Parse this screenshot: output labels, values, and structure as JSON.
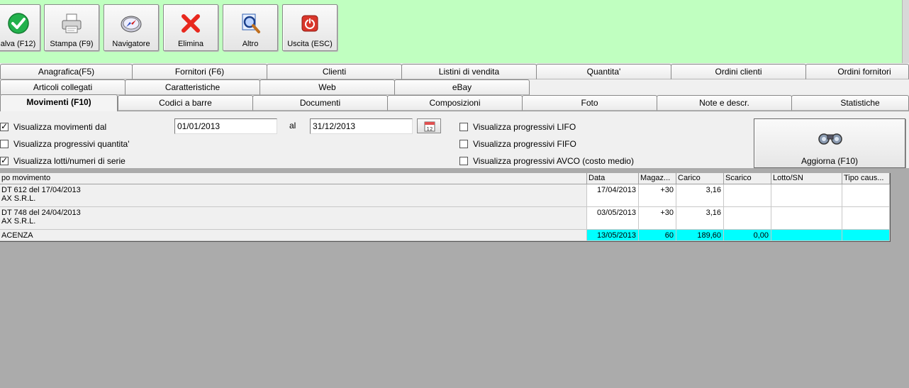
{
  "toolbar": {
    "buttons": [
      {
        "label": "alva (F12)",
        "icon": "check-icon"
      },
      {
        "label": "Stampa (F9)",
        "icon": "printer-icon"
      },
      {
        "label": "Navigatore",
        "icon": "compass-icon"
      },
      {
        "label": "Elimina",
        "icon": "delete-x-icon"
      },
      {
        "label": "Altro",
        "icon": "search-doc-icon"
      },
      {
        "label": "Uscita (ESC)",
        "icon": "power-icon"
      }
    ],
    "colors": {
      "background": "#c0ffc0",
      "check": "#22b14c",
      "delete": "#e8281e",
      "exit": "#d9362b"
    }
  },
  "tabs": {
    "row1": [
      "Anagrafica(F5)",
      "Fornitori (F6)",
      "Clienti",
      "Listini di vendita",
      "Quantita'",
      "Ordini clienti",
      "Ordini fornitori"
    ],
    "row2": [
      "Articoli collegati",
      "Caratteristiche",
      "Web",
      "eBay"
    ],
    "row3": [
      "Movimenti (F10)",
      "Codici a barre",
      "Documenti",
      "Composizioni",
      "Foto",
      "Note e descr.",
      "Statistiche"
    ],
    "active": "Movimenti (F10)"
  },
  "filters": {
    "show_movements": {
      "label": "Visualizza movimenti dal",
      "checked": true
    },
    "show_qty_progressive": {
      "label": "Visualizza progressivi quantita'",
      "checked": false
    },
    "show_lots": {
      "label": "Visualizza lotti/numeri di serie",
      "checked": true
    },
    "date_from": "01/01/2013",
    "al_label": "al",
    "date_to": "31/12/2013",
    "lifo": {
      "label": "Visualizza progressivi LIFO",
      "checked": false
    },
    "fifo": {
      "label": "Visualizza progressivi FIFO",
      "checked": false
    },
    "avco": {
      "label": "Visualizza progressivi AVCO (costo medio)",
      "checked": false
    },
    "refresh_label": "Aggiorna (F10)"
  },
  "grid": {
    "columns": [
      "po movimento",
      "Data",
      "Magaz...",
      "Carico",
      "Scarico",
      "Lotto/SN",
      "Tipo caus..."
    ],
    "rows": [
      {
        "desc1": "DT 612 del 17/04/2013",
        "desc2": "AX S.R.L.",
        "data": "17/04/2013",
        "magaz": "+30",
        "carico": "3,16",
        "scarico": "",
        "lotto": "",
        "tipo": ""
      },
      {
        "desc1": "DT 748 del 24/04/2013",
        "desc2": "AX S.R.L.",
        "data": "03/05/2013",
        "magaz": "+30",
        "carico": "3,16",
        "scarico": "",
        "lotto": "",
        "tipo": ""
      }
    ],
    "total": {
      "desc": "ACENZA",
      "data": "13/05/2013",
      "magaz": "60",
      "carico": "189,60",
      "scarico": "0,00",
      "lotto": "",
      "tipo": ""
    },
    "colors": {
      "total_row": "#00ffff"
    }
  }
}
